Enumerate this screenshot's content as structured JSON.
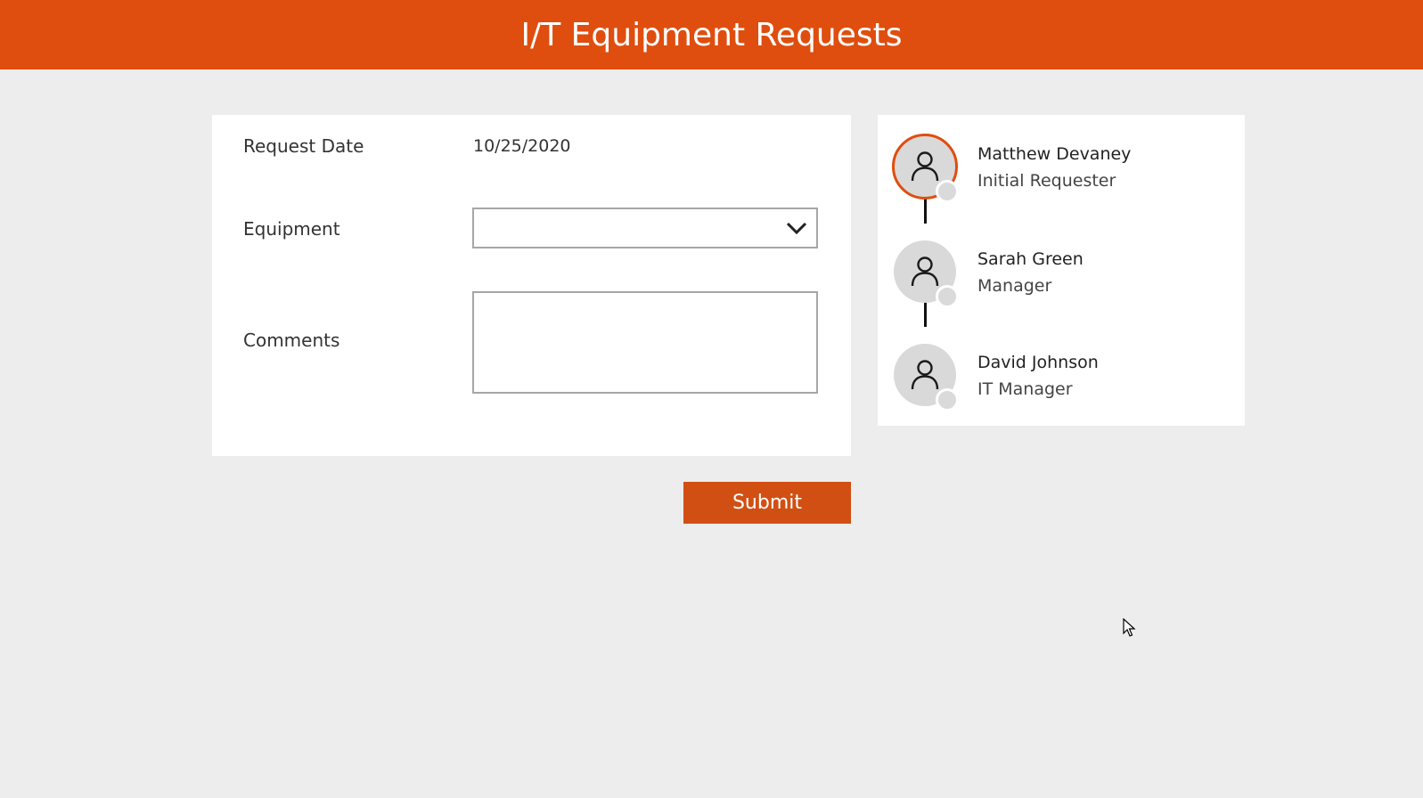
{
  "header": {
    "title": "I/T Equipment Requests"
  },
  "form": {
    "request_date_label": "Request Date",
    "request_date_value": "10/25/2020",
    "equipment_label": "Equipment",
    "equipment_value": "",
    "comments_label": "Comments",
    "comments_value": ""
  },
  "submit": {
    "label": "Submit"
  },
  "approvers": [
    {
      "name": "Matthew Devaney",
      "role": "Initial Requester",
      "active": true
    },
    {
      "name": "Sarah Green",
      "role": "Manager",
      "active": false
    },
    {
      "name": "David Johnson",
      "role": "IT Manager",
      "active": false
    }
  ],
  "icons": {
    "dropdown": "chevron-down-icon",
    "avatar": "person-icon",
    "status": "status-dot"
  },
  "colors": {
    "accent": "#DF4E0E",
    "button": "#D14F13",
    "background": "#EDEDED"
  }
}
